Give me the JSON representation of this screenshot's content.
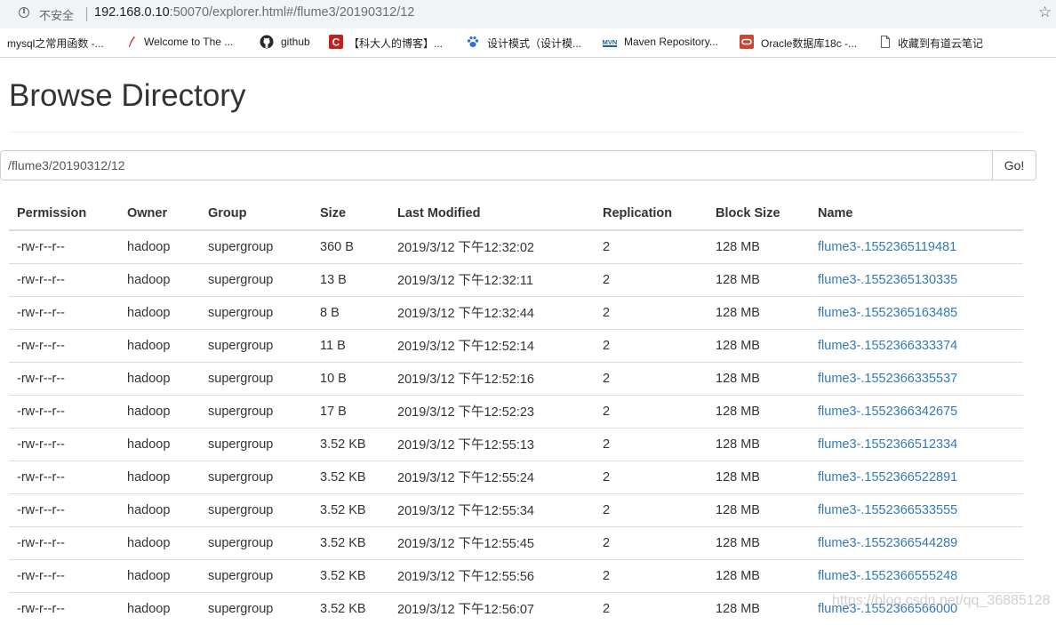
{
  "browser": {
    "security_label": "不安全",
    "url_host": "192.168.0.10",
    "url_rest": ":50070/explorer.html#/flume3/20190312/12",
    "bookmarks": [
      {
        "label": "mysql之常用函数 -...",
        "icon": "none"
      },
      {
        "label": "Welcome to The ...",
        "icon": "feather-icon"
      },
      {
        "label": "github",
        "icon": "github-icon"
      },
      {
        "label": "【科大人的博客】...",
        "icon": "csdn-icon"
      },
      {
        "label": "设计模式（设计模...",
        "icon": "baidu-paw-icon"
      },
      {
        "label": "Maven Repository...",
        "icon": "mvn-icon"
      },
      {
        "label": "Oracle数据库18c -...",
        "icon": "oracle-icon"
      },
      {
        "label": "收藏到有道云笔记",
        "icon": "document-icon"
      }
    ]
  },
  "page": {
    "title": "Browse Directory",
    "path_value": "/flume3/20190312/12",
    "go_label": "Go!"
  },
  "table": {
    "headers": [
      "Permission",
      "Owner",
      "Group",
      "Size",
      "Last Modified",
      "Replication",
      "Block Size",
      "Name"
    ],
    "rows": [
      {
        "permission": "-rw-r--r--",
        "owner": "hadoop",
        "group": "supergroup",
        "size": "360 B",
        "modified": "2019/3/12 下午12:32:02",
        "replication": "2",
        "block_size": "128 MB",
        "name": "flume3-.1552365119481"
      },
      {
        "permission": "-rw-r--r--",
        "owner": "hadoop",
        "group": "supergroup",
        "size": "13 B",
        "modified": "2019/3/12 下午12:32:11",
        "replication": "2",
        "block_size": "128 MB",
        "name": "flume3-.1552365130335"
      },
      {
        "permission": "-rw-r--r--",
        "owner": "hadoop",
        "group": "supergroup",
        "size": "8 B",
        "modified": "2019/3/12 下午12:32:44",
        "replication": "2",
        "block_size": "128 MB",
        "name": "flume3-.1552365163485"
      },
      {
        "permission": "-rw-r--r--",
        "owner": "hadoop",
        "group": "supergroup",
        "size": "11 B",
        "modified": "2019/3/12 下午12:52:14",
        "replication": "2",
        "block_size": "128 MB",
        "name": "flume3-.1552366333374"
      },
      {
        "permission": "-rw-r--r--",
        "owner": "hadoop",
        "group": "supergroup",
        "size": "10 B",
        "modified": "2019/3/12 下午12:52:16",
        "replication": "2",
        "block_size": "128 MB",
        "name": "flume3-.1552366335537"
      },
      {
        "permission": "-rw-r--r--",
        "owner": "hadoop",
        "group": "supergroup",
        "size": "17 B",
        "modified": "2019/3/12 下午12:52:23",
        "replication": "2",
        "block_size": "128 MB",
        "name": "flume3-.1552366342675"
      },
      {
        "permission": "-rw-r--r--",
        "owner": "hadoop",
        "group": "supergroup",
        "size": "3.52 KB",
        "modified": "2019/3/12 下午12:55:13",
        "replication": "2",
        "block_size": "128 MB",
        "name": "flume3-.1552366512334"
      },
      {
        "permission": "-rw-r--r--",
        "owner": "hadoop",
        "group": "supergroup",
        "size": "3.52 KB",
        "modified": "2019/3/12 下午12:55:24",
        "replication": "2",
        "block_size": "128 MB",
        "name": "flume3-.1552366522891"
      },
      {
        "permission": "-rw-r--r--",
        "owner": "hadoop",
        "group": "supergroup",
        "size": "3.52 KB",
        "modified": "2019/3/12 下午12:55:34",
        "replication": "2",
        "block_size": "128 MB",
        "name": "flume3-.1552366533555"
      },
      {
        "permission": "-rw-r--r--",
        "owner": "hadoop",
        "group": "supergroup",
        "size": "3.52 KB",
        "modified": "2019/3/12 下午12:55:45",
        "replication": "2",
        "block_size": "128 MB",
        "name": "flume3-.1552366544289"
      },
      {
        "permission": "-rw-r--r--",
        "owner": "hadoop",
        "group": "supergroup",
        "size": "3.52 KB",
        "modified": "2019/3/12 下午12:55:56",
        "replication": "2",
        "block_size": "128 MB",
        "name": "flume3-.1552366555248"
      },
      {
        "permission": "-rw-r--r--",
        "owner": "hadoop",
        "group": "supergroup",
        "size": "3.52 KB",
        "modified": "2019/3/12 下午12:56:07",
        "replication": "2",
        "block_size": "128 MB",
        "name": "flume3-.1552366566000"
      }
    ]
  },
  "watermark": "https://blog.csdn.net/qq_36885128",
  "colors": {
    "link": "#337ab7",
    "text": "#333333",
    "border": "#dddddd",
    "chrome_bar": "#f1f3f4"
  }
}
